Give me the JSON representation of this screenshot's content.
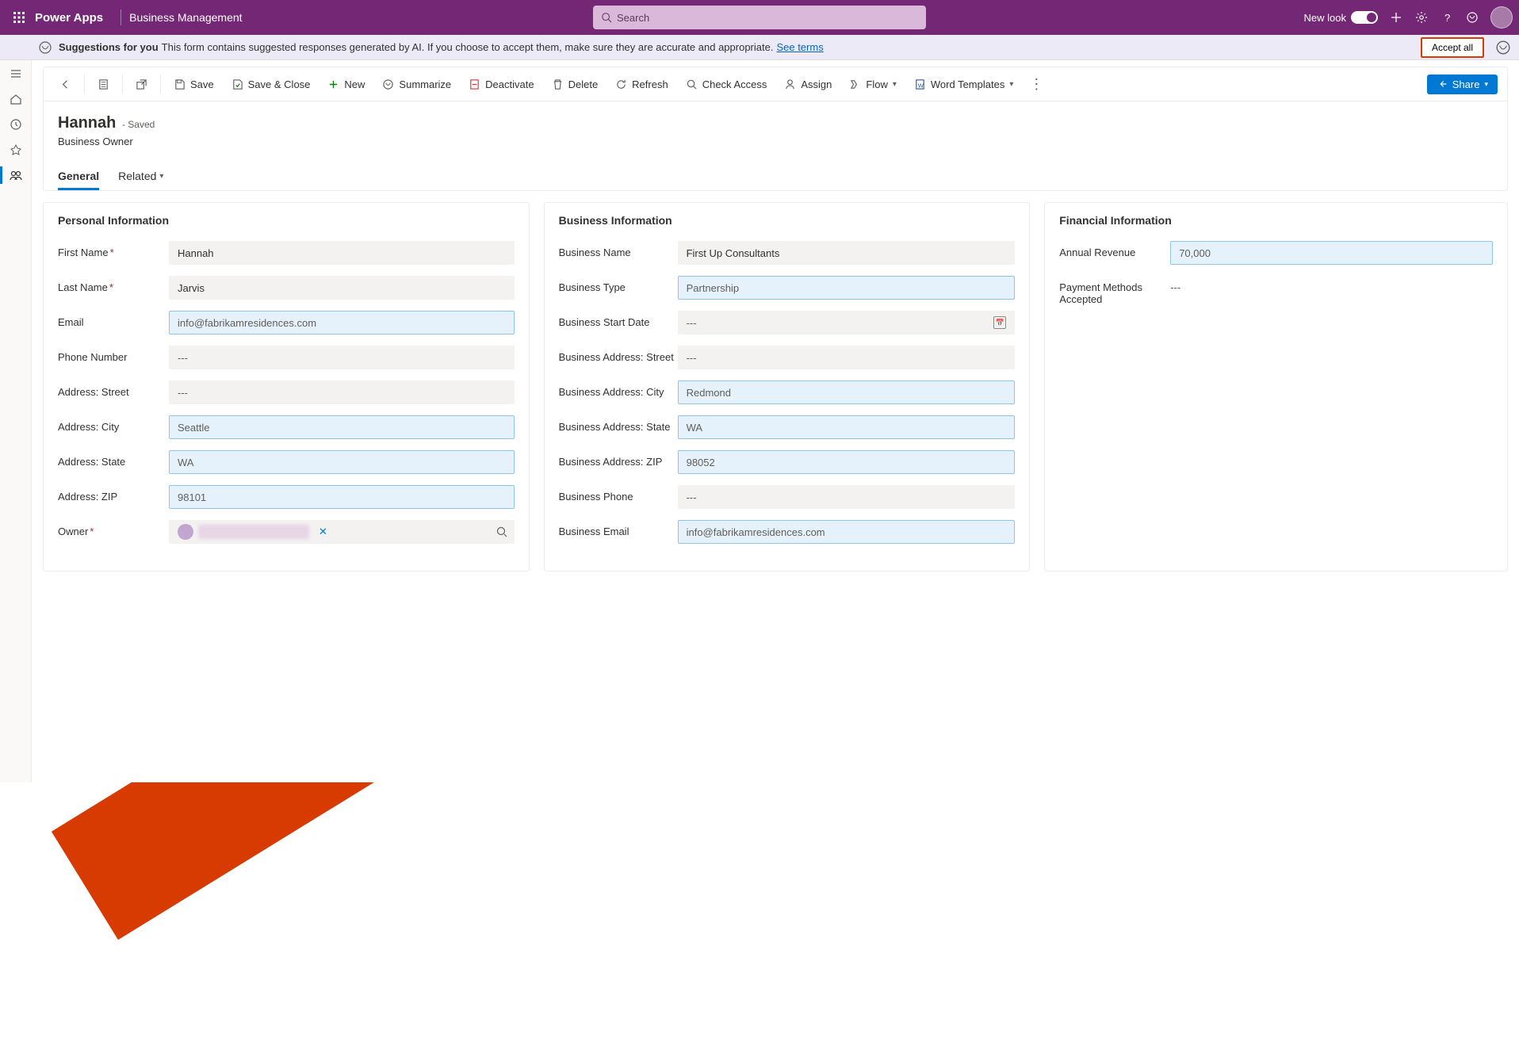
{
  "header": {
    "app": "Power Apps",
    "sub": "Business Management",
    "search_placeholder": "Search",
    "new_look": "New look"
  },
  "suggestion": {
    "bold": "Suggestions for you",
    "text": "This form contains suggested responses generated by AI. If you choose to accept them, make sure they are accurate and appropriate.",
    "link": "See terms",
    "accept": "Accept all"
  },
  "commands": {
    "save": "Save",
    "save_close": "Save & Close",
    "new": "New",
    "summarize": "Summarize",
    "deactivate": "Deactivate",
    "delete": "Delete",
    "refresh": "Refresh",
    "check_access": "Check Access",
    "assign": "Assign",
    "flow": "Flow",
    "word_templates": "Word Templates",
    "share": "Share"
  },
  "record": {
    "title": "Hannah",
    "saved": "- Saved",
    "subtitle": "Business Owner",
    "tabs": {
      "general": "General",
      "related": "Related"
    }
  },
  "sections": {
    "personal": "Personal Information",
    "business": "Business Information",
    "financial": "Financial Information"
  },
  "labels": {
    "first_name": "First Name",
    "last_name": "Last Name",
    "email": "Email",
    "phone": "Phone Number",
    "addr_street": "Address: Street",
    "addr_city": "Address: City",
    "addr_state": "Address: State",
    "addr_zip": "Address: ZIP",
    "owner": "Owner",
    "biz_name": "Business Name",
    "biz_type": "Business Type",
    "biz_start": "Business Start Date",
    "biz_addr_street": "Business Address: Street",
    "biz_addr_city": "Business Address: City",
    "biz_addr_state": "Business Address: State",
    "biz_addr_zip": "Business Address: ZIP",
    "biz_phone": "Business Phone",
    "biz_email": "Business Email",
    "annual_rev": "Annual Revenue",
    "pay_methods": "Payment Methods Accepted"
  },
  "values": {
    "first_name": "Hannah",
    "last_name": "Jarvis",
    "email": "info@fabrikamresidences.com",
    "phone": "---",
    "addr_street": "---",
    "addr_city": "Seattle",
    "addr_state": "WA",
    "addr_zip": "98101",
    "biz_name": "First Up Consultants",
    "biz_type": "Partnership",
    "biz_start": "---",
    "biz_addr_street": "---",
    "biz_addr_city": "Redmond",
    "biz_addr_state": "WA",
    "biz_addr_zip": "98052",
    "biz_phone": "---",
    "biz_email": "info@fabrikamresidences.com",
    "annual_rev": "70,000",
    "pay_methods": "---"
  }
}
